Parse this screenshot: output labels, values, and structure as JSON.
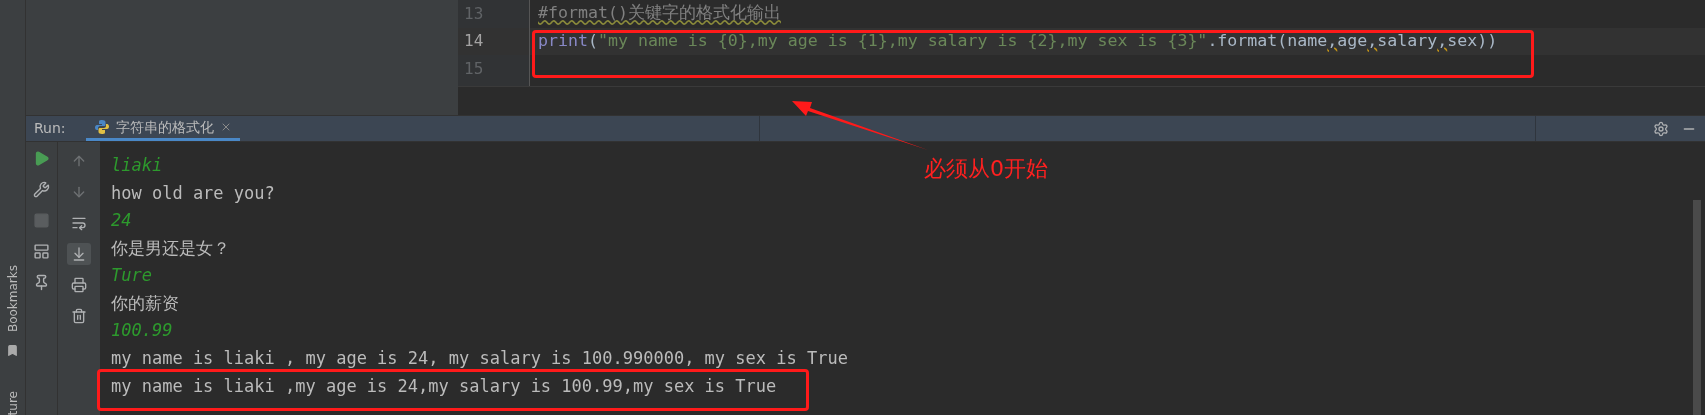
{
  "side_strip": {
    "bookmarks_label": "Bookmarks",
    "structure_label": "ture"
  },
  "editor": {
    "lines": [
      {
        "number": "13",
        "current": false,
        "tokens": [
          {
            "kind": "comment",
            "text": "#format()关键字的格式化输出"
          }
        ]
      },
      {
        "number": "14",
        "current": true,
        "tokens": [
          {
            "kind": "keyword",
            "text": "print"
          },
          {
            "kind": "plain",
            "text": "("
          },
          {
            "kind": "string",
            "text": "\"my name is {0},my age is {1},my salary is {2},my sex is {3}\""
          },
          {
            "kind": "plain",
            "text": ".format(name"
          },
          {
            "kind": "warn",
            "text": ","
          },
          {
            "kind": "plain",
            "text": "age"
          },
          {
            "kind": "warn",
            "text": ","
          },
          {
            "kind": "plain",
            "text": "salary"
          },
          {
            "kind": "warn",
            "text": ","
          },
          {
            "kind": "plain",
            "text": "sex))"
          }
        ]
      },
      {
        "number": "15",
        "current": false
      }
    ]
  },
  "run": {
    "label": "Run:",
    "tabs": [
      {
        "label": "字符串的格式化",
        "selected": true
      }
    ]
  },
  "toolbar_left": [
    {
      "kind": "run",
      "disabled": false
    },
    {
      "kind": "wrench",
      "disabled": false
    },
    {
      "kind": "stop",
      "disabled": true
    },
    {
      "kind": "layout",
      "disabled": false
    },
    {
      "kind": "pin",
      "disabled": false
    }
  ],
  "toolbar_right": [
    {
      "kind": "up",
      "active": false
    },
    {
      "kind": "down",
      "active": false
    },
    {
      "kind": "wrap",
      "active": false
    },
    {
      "kind": "scroll-end",
      "active": true
    },
    {
      "kind": "print",
      "active": false
    },
    {
      "kind": "trash",
      "active": false
    }
  ],
  "console": {
    "lines": [
      {
        "kind": "input",
        "text": "liaki",
        "highlighted": false
      },
      {
        "kind": "output",
        "text": "how old are you?",
        "highlighted": false
      },
      {
        "kind": "input",
        "text": "24",
        "highlighted": false
      },
      {
        "kind": "output",
        "text": "你是男还是女？",
        "highlighted": false
      },
      {
        "kind": "input",
        "text": "Ture",
        "highlighted": false
      },
      {
        "kind": "output",
        "text": "你的薪资",
        "highlighted": false
      },
      {
        "kind": "input",
        "text": "100.99",
        "highlighted": false
      },
      {
        "kind": "output",
        "text": "my name is liaki , my age is 24, my salary is 100.990000, my sex is True",
        "highlighted": false
      },
      {
        "kind": "output",
        "text": "my name is liaki ,my age is 24,my salary is 100.99,my sex is True",
        "highlighted": true
      }
    ]
  },
  "annotation": {
    "note": "必须从0开始"
  }
}
